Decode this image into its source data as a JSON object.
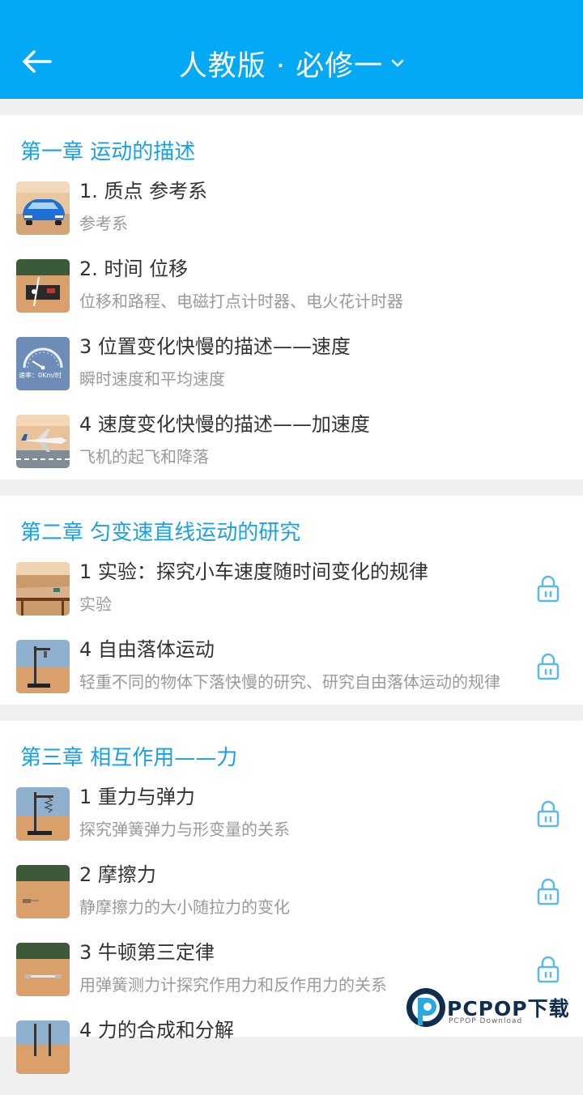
{
  "header": {
    "title": "人教版 · 必修一"
  },
  "chapters": [
    {
      "title": "第一章 运动的描述",
      "items": [
        {
          "title": "1. 质点 参考系",
          "subtitle": "参考系",
          "locked": false
        },
        {
          "title": "2. 时间 位移",
          "subtitle": "位移和路程、电磁打点计时器、电火花计时器",
          "locked": false
        },
        {
          "title": "3 位置变化快慢的描述——速度",
          "subtitle": "瞬时速度和平均速度",
          "locked": false,
          "thumb_text": "速率：0Km/时"
        },
        {
          "title": "4 速度变化快慢的描述——加速度",
          "subtitle": "飞机的起飞和降落",
          "locked": false
        }
      ]
    },
    {
      "title": "第二章 匀变速直线运动的研究",
      "items": [
        {
          "title": "1 实验：探究小车速度随时间变化的规律",
          "subtitle": "实验",
          "locked": true
        },
        {
          "title": "4 自由落体运动",
          "subtitle": "轻重不同的物体下落快慢的研究、研究自由落体运动的规律",
          "locked": true
        }
      ]
    },
    {
      "title": "第三章 相互作用——力",
      "items": [
        {
          "title": "1 重力与弹力",
          "subtitle": "探究弹簧弹力与形变量的关系",
          "locked": true
        },
        {
          "title": "2 摩擦力",
          "subtitle": "静摩擦力的大小随拉力的变化",
          "locked": true
        },
        {
          "title": "3 牛顿第三定律",
          "subtitle": "用弹簧测力计探究作用力和反作用力的关系",
          "locked": true
        },
        {
          "title": "4 力的合成和分解",
          "subtitle": "",
          "locked": true
        }
      ]
    }
  ],
  "watermark": {
    "brand": "PCPOP下载",
    "sub": "PCPOP Download"
  },
  "colors": {
    "header": "#03a9f4",
    "chapter_title": "#1aa0e8",
    "lock": "#5ab8ec"
  }
}
